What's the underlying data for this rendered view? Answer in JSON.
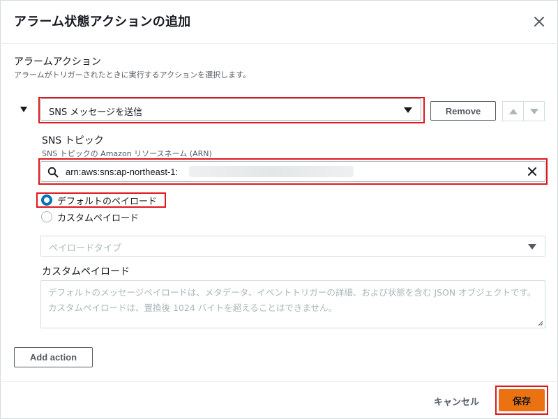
{
  "dialog": {
    "title": "アラーム状態アクションの追加",
    "close_icon": "close-icon"
  },
  "section": {
    "title": "アラームアクション",
    "description": "アラームがトリガーされたときに実行するアクションを選択します。"
  },
  "action": {
    "type_value": "SNS メッセージを送信",
    "remove_label": "Remove",
    "move_up_icon": "chevron-up-icon",
    "move_down_icon": "chevron-down-icon"
  },
  "sns_topic": {
    "label": "SNS トピック",
    "description": "SNS トピックの Amazon リソースネーム (ARN)",
    "value": "arn:aws:sns:ap-northeast-1:",
    "search_icon": "search-icon",
    "clear_icon": "clear-icon"
  },
  "payload": {
    "options": [
      {
        "label": "デフォルトのペイロード",
        "selected": true
      },
      {
        "label": "カスタムペイロード",
        "selected": false
      }
    ],
    "type_placeholder": "ペイロードタイプ",
    "custom_label": "カスタムペイロード",
    "custom_placeholder": "デフォルトのメッセージペイロードは、メタデータ、イベントトリガーの詳細、および状態を含む JSON オブジェクトです。カスタムペイロードは、置換後 1024 バイトを超えることはできません。"
  },
  "add_action_label": "Add action",
  "footer": {
    "cancel_label": "キャンセル",
    "save_label": "保存"
  },
  "colors": {
    "primary": "#ec7211",
    "highlight": "#e0151d",
    "radio_selected": "#0073bb"
  }
}
